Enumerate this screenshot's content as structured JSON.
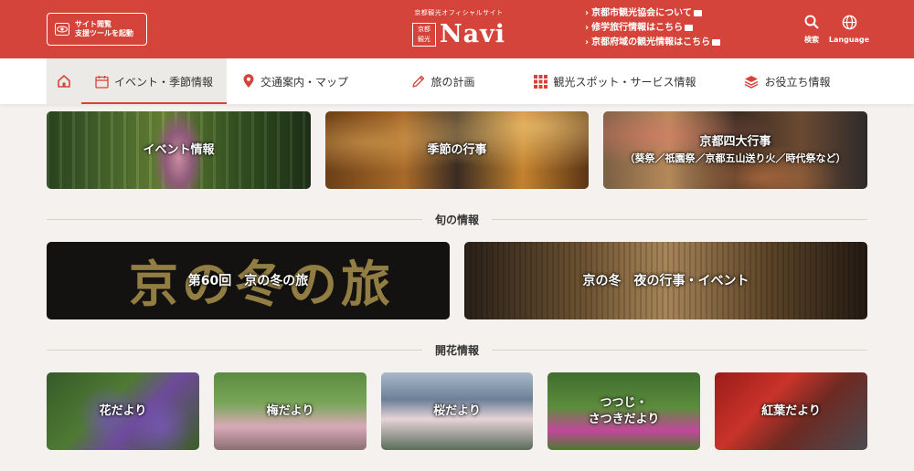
{
  "header": {
    "support_tool": [
      "サイト閲覧",
      "支援ツールを起動"
    ],
    "logo": {
      "kicker": "京都観光オフィシャルサイト",
      "stamp": [
        "京都",
        "観光"
      ],
      "name": "Navi"
    },
    "links": [
      "京都市観光協会について",
      "修学旅行情報はこちら",
      "京都府域の観光情報はこちら"
    ],
    "search_label": "検索",
    "language_label": "Language"
  },
  "nav": {
    "items": [
      {
        "label": "イベント・季節情報",
        "icon": "calendar-icon"
      },
      {
        "label": "交通案内・マップ",
        "icon": "map-pin-icon"
      },
      {
        "label": "旅の計画",
        "icon": "pencil-icon"
      },
      {
        "label": "観光スポット・サービス情報",
        "icon": "grid-icon"
      },
      {
        "label": "お役立ち情報",
        "icon": "stack-icon"
      }
    ]
  },
  "top_tiles": [
    {
      "title": "イベント情報"
    },
    {
      "title": "季節の行事"
    },
    {
      "title": "京都四大行事",
      "subtitle": "（葵祭／祇園祭／京都五山送り火／時代祭など）"
    }
  ],
  "sections": {
    "seasonal": "旬の情報",
    "flowers": "開花情報"
  },
  "seasonal_tiles": [
    {
      "title": "第60回　京の冬の旅",
      "art_text": "京の冬の旅"
    },
    {
      "title": "京の冬　夜の行事・イベント"
    }
  ],
  "flower_tiles": [
    {
      "title": "花だより"
    },
    {
      "title": "梅だより"
    },
    {
      "title": "桜だより"
    },
    {
      "title": "つつじ・\nさつきだより",
      "line1": "つつじ・",
      "line2": "さつきだより"
    },
    {
      "title": "紅葉だより"
    }
  ],
  "colors": {
    "brand": "#d5443a",
    "nav_active_bg": "#eceae7"
  }
}
